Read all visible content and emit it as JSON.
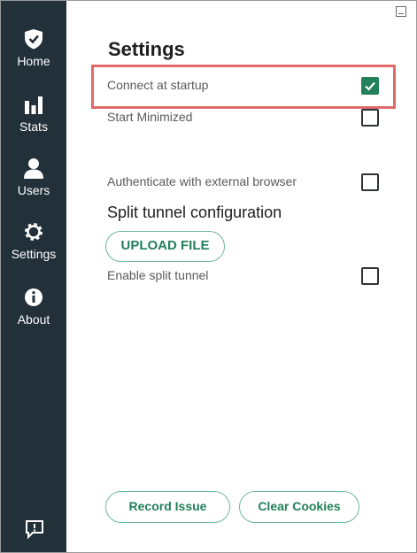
{
  "sidebar": {
    "items": [
      {
        "label": "Home",
        "icon": "shield-icon"
      },
      {
        "label": "Stats",
        "icon": "bar-chart-icon"
      },
      {
        "label": "Users",
        "icon": "user-icon"
      },
      {
        "label": "Settings",
        "icon": "gear-icon"
      },
      {
        "label": "About",
        "icon": "info-icon"
      }
    ],
    "active": "Settings",
    "feedback_icon": "feedback-icon"
  },
  "settings": {
    "title": "Settings",
    "options": [
      {
        "label": "Connect at startup",
        "checked": true
      },
      {
        "label": "Start Minimized",
        "checked": false
      },
      {
        "label": "Authenticate with external browser",
        "checked": false
      }
    ],
    "split_tunnel": {
      "title": "Split tunnel configuration",
      "upload_label": "UPLOAD FILE",
      "enable_label": "Enable split tunnel",
      "enable_checked": false
    }
  },
  "footer": {
    "record_label": "Record Issue",
    "clear_label": "Clear Cookies"
  },
  "colors": {
    "sidebar_bg": "#22303a",
    "accent_green": "#22805a",
    "highlight_red": "#e06a6a"
  }
}
